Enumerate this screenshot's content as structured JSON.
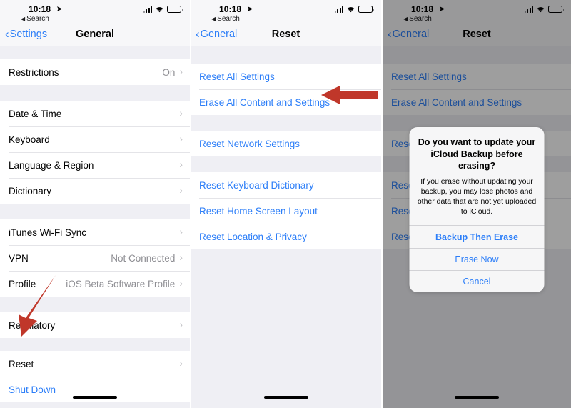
{
  "colors": {
    "accent_blue": "#2c7ef8",
    "arrow_red": "#c0372a",
    "list_bg": "#efeff4",
    "row_bg": "#ffffff",
    "secondary_text": "#8e8e93"
  },
  "status_bar": {
    "time": "10:18",
    "location_icon": "location-arrow-icon",
    "back_app_label": "Search",
    "signal_icon": "cellular-signal-icon",
    "wifi_icon": "wifi-icon",
    "battery_icon": "battery-icon"
  },
  "panels": [
    {
      "id": "general",
      "nav": {
        "back_label": "Settings",
        "title": "General"
      },
      "groups": [
        {
          "top_gap": 18,
          "rows": [
            {
              "label": "Restrictions",
              "value": "On",
              "chevron": true,
              "style": "plain"
            }
          ]
        },
        {
          "top_gap": 22,
          "rows": [
            {
              "label": "Date & Time",
              "value": "",
              "chevron": true,
              "style": "plain"
            },
            {
              "label": "Keyboard",
              "value": "",
              "chevron": true,
              "style": "plain"
            },
            {
              "label": "Language & Region",
              "value": "",
              "chevron": true,
              "style": "plain"
            },
            {
              "label": "Dictionary",
              "value": "",
              "chevron": true,
              "style": "plain"
            }
          ]
        },
        {
          "top_gap": 22,
          "rows": [
            {
              "label": "iTunes Wi-Fi Sync",
              "value": "",
              "chevron": true,
              "style": "plain"
            },
            {
              "label": "VPN",
              "value": "Not Connected",
              "chevron": true,
              "style": "plain"
            },
            {
              "label": "Profile",
              "value": "iOS Beta Software Profile",
              "chevron": true,
              "style": "plain"
            }
          ]
        },
        {
          "top_gap": 22,
          "rows": [
            {
              "label": "Regulatory",
              "value": "",
              "chevron": true,
              "style": "plain"
            }
          ]
        },
        {
          "top_gap": 18,
          "rows": [
            {
              "label": "Reset",
              "value": "",
              "chevron": true,
              "style": "plain"
            },
            {
              "label": "Shut Down",
              "value": "",
              "chevron": false,
              "style": "blue"
            }
          ]
        }
      ]
    },
    {
      "id": "reset",
      "nav": {
        "back_label": "General",
        "title": "Reset"
      },
      "groups": [
        {
          "top_gap": 24,
          "rows": [
            {
              "label": "Reset All Settings",
              "value": "",
              "chevron": false,
              "style": "blue"
            },
            {
              "label": "Erase All Content and Settings",
              "value": "",
              "chevron": false,
              "style": "blue"
            }
          ]
        },
        {
          "top_gap": 22,
          "rows": [
            {
              "label": "Reset Network Settings",
              "value": "",
              "chevron": false,
              "style": "blue"
            }
          ]
        },
        {
          "top_gap": 22,
          "rows": [
            {
              "label": "Reset Keyboard Dictionary",
              "value": "",
              "chevron": false,
              "style": "blue"
            },
            {
              "label": "Reset Home Screen Layout",
              "value": "",
              "chevron": false,
              "style": "blue"
            },
            {
              "label": "Reset Location & Privacy",
              "value": "",
              "chevron": false,
              "style": "blue"
            }
          ]
        }
      ]
    },
    {
      "id": "reset-dimmed",
      "nav": {
        "back_label": "General",
        "title": "Reset"
      },
      "groups": [
        {
          "top_gap": 24,
          "rows": [
            {
              "label": "Reset All Settings",
              "value": "",
              "chevron": false,
              "style": "blue"
            },
            {
              "label": "Erase All Content and Settings",
              "value": "",
              "chevron": false,
              "style": "blue"
            }
          ]
        },
        {
          "top_gap": 22,
          "rows": [
            {
              "label": "Reset Network Settings",
              "value": "",
              "chevron": false,
              "style": "blue"
            }
          ]
        },
        {
          "top_gap": 22,
          "rows": [
            {
              "label": "Reset Keyboard Dictionary",
              "value": "",
              "chevron": false,
              "style": "blue"
            },
            {
              "label": "Reset Home Screen Layout",
              "value": "",
              "chevron": false,
              "style": "blue"
            },
            {
              "label": "Reset Location & Privacy",
              "value": "",
              "chevron": false,
              "style": "blue"
            }
          ]
        }
      ]
    }
  ],
  "alert": {
    "title": "Do you want to update your iCloud Backup before erasing?",
    "message": "If you erase without updating your backup, you may lose photos and other data that are not yet uploaded to iCloud.",
    "buttons": [
      {
        "label": "Backup Then Erase",
        "bold": true
      },
      {
        "label": "Erase Now",
        "bold": false
      },
      {
        "label": "Cancel",
        "bold": false
      }
    ]
  },
  "annotations": [
    {
      "id": "arrow-down",
      "points_to": "Reset",
      "direction": "down-left",
      "color": "#c0372a"
    },
    {
      "id": "arrow-left",
      "points_to": "Erase All Content and Settings",
      "direction": "left",
      "color": "#c0372a"
    }
  ]
}
